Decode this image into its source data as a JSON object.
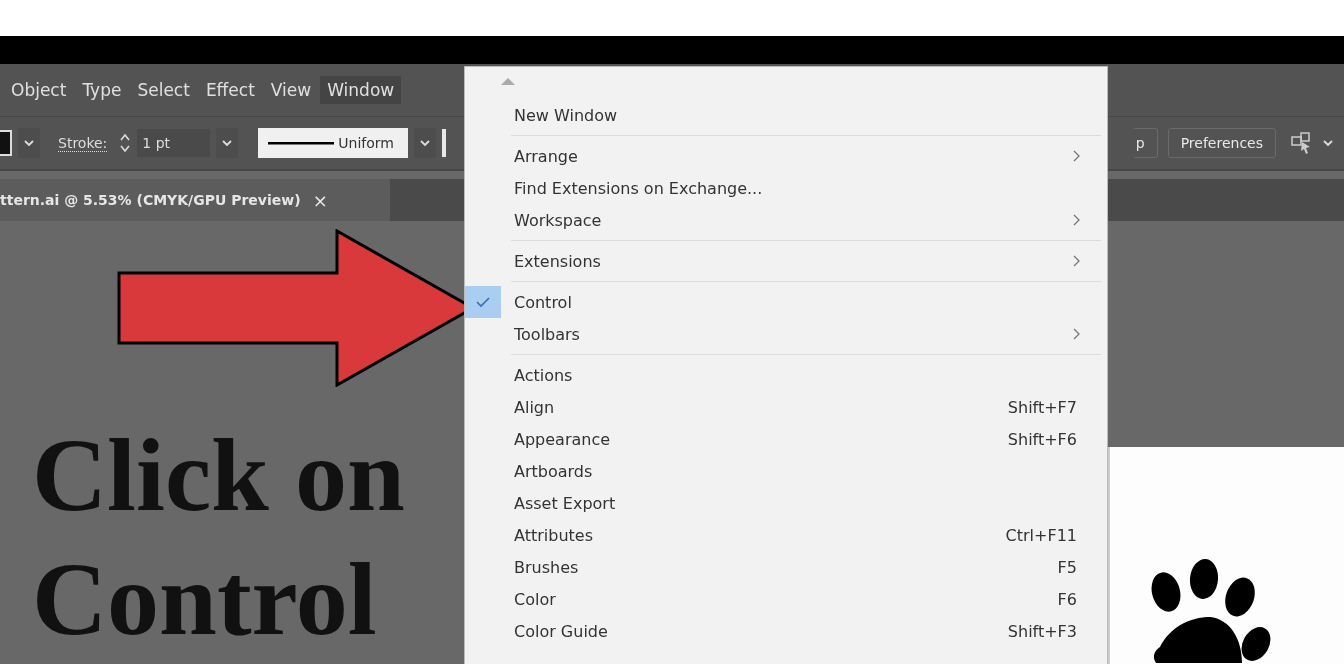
{
  "menubar": {
    "items": [
      {
        "label": "Object",
        "selected": false
      },
      {
        "label": "Type",
        "selected": false
      },
      {
        "label": "Select",
        "selected": false
      },
      {
        "label": "Effect",
        "selected": false
      },
      {
        "label": "View",
        "selected": false
      },
      {
        "label": "Window",
        "selected": true
      }
    ]
  },
  "toolbar": {
    "stroke_label": "Stroke:",
    "stroke_weight": "1 pt",
    "profile": "Uniform",
    "partial_button": "p",
    "preferences_button": "Preferences"
  },
  "document_tab": {
    "title": "ttern.ai @ 5.53% (CMYK/GPU Preview)",
    "close": "×"
  },
  "canvas": {
    "heading_lines": [
      "Click on",
      "Control"
    ]
  },
  "window_menu": {
    "items": [
      {
        "kind": "item",
        "label": "New Window",
        "checked": false,
        "has_submenu": false
      },
      {
        "kind": "separator"
      },
      {
        "kind": "item",
        "label": "Arrange",
        "checked": false,
        "has_submenu": true
      },
      {
        "kind": "item",
        "label": "Find Extensions on Exchange...",
        "checked": false,
        "has_submenu": false
      },
      {
        "kind": "item",
        "label": "Workspace",
        "checked": false,
        "has_submenu": true
      },
      {
        "kind": "separator"
      },
      {
        "kind": "item",
        "label": "Extensions",
        "checked": false,
        "has_submenu": true
      },
      {
        "kind": "separator"
      },
      {
        "kind": "item",
        "label": "Control",
        "checked": true,
        "has_submenu": false
      },
      {
        "kind": "item",
        "label": "Toolbars",
        "checked": false,
        "has_submenu": true
      },
      {
        "kind": "separator"
      },
      {
        "kind": "item",
        "label": "Actions",
        "checked": false,
        "has_submenu": false
      },
      {
        "kind": "item",
        "label": "Align",
        "shortcut": "Shift+F7",
        "checked": false,
        "has_submenu": false
      },
      {
        "kind": "item",
        "label": "Appearance",
        "shortcut": "Shift+F6",
        "checked": false,
        "has_submenu": false
      },
      {
        "kind": "item",
        "label": "Artboards",
        "checked": false,
        "has_submenu": false
      },
      {
        "kind": "item",
        "label": "Asset Export",
        "checked": false,
        "has_submenu": false
      },
      {
        "kind": "item",
        "label": "Attributes",
        "shortcut": "Ctrl+F11",
        "checked": false,
        "has_submenu": false
      },
      {
        "kind": "item",
        "label": "Brushes",
        "shortcut": "F5",
        "checked": false,
        "has_submenu": false
      },
      {
        "kind": "item",
        "label": "Color",
        "shortcut": "F6",
        "checked": false,
        "has_submenu": false
      },
      {
        "kind": "item",
        "label": "Color Guide",
        "shortcut": "Shift+F3",
        "checked": false,
        "has_submenu": false
      }
    ]
  }
}
